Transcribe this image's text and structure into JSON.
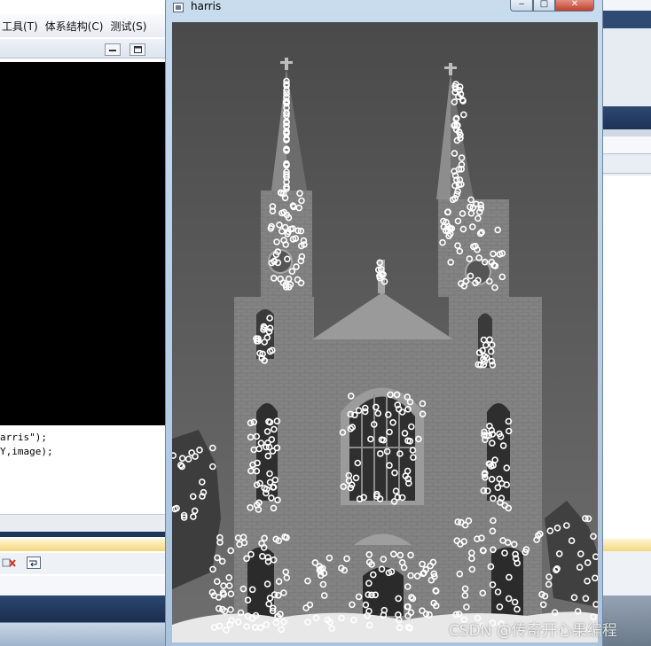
{
  "background_ide": {
    "menu": [
      "工具(T)",
      "体系结构(C)",
      "测试(S)"
    ],
    "code_lines": [
      "arris\");",
      "Y,image);"
    ]
  },
  "window": {
    "title": "harris",
    "buttons": {
      "minimize": "‒",
      "maximize": "□",
      "close": "✕"
    }
  },
  "image": {
    "description_icon": "church-image",
    "corner_marker_color": "#ffffff"
  },
  "watermark": "CSDN @传奇开心果编程",
  "colors": {
    "titlebar": "#b7cfe6",
    "close_button": "#c1412b",
    "ide_navy": "#1d3558"
  }
}
